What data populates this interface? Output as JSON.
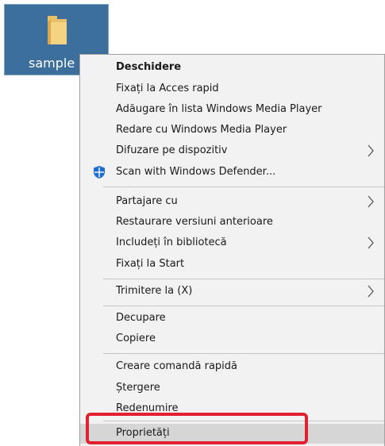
{
  "desktop": {
    "icon_label": "sample"
  },
  "context_menu": {
    "items": [
      {
        "label": "Deschidere",
        "bold": true
      },
      {
        "label": "Fixați la Acces rapid"
      },
      {
        "label": "Adăugare în lista Windows Media Player"
      },
      {
        "label": "Redare cu Windows Media Player"
      },
      {
        "label": "Difuzare pe dispozitiv",
        "submenu": true
      },
      {
        "label": "Scan with Windows Defender...",
        "icon": "windows-defender-shield-icon"
      },
      {
        "label": "Partajare cu",
        "submenu": true
      },
      {
        "label": "Restaurare versiuni anterioare"
      },
      {
        "label": "Includeți în bibliotecă",
        "submenu": true
      },
      {
        "label": "Fixați la Start"
      },
      {
        "label": "Trimitere la (X)",
        "submenu": true
      },
      {
        "label": "Decupare"
      },
      {
        "label": "Copiere"
      },
      {
        "label": "Creare comandă rapidă"
      },
      {
        "label": "Ștergere"
      },
      {
        "label": "Redenumire"
      },
      {
        "label": "Proprietăți",
        "highlighted": true
      }
    ]
  },
  "colors": {
    "selection_bg": "#3d6f9d",
    "menu_bg": "#f2f2f2",
    "hover_bg": "#d6d6d6",
    "annotation": "#e3202f",
    "defender_blue": "#1f6fd1"
  }
}
